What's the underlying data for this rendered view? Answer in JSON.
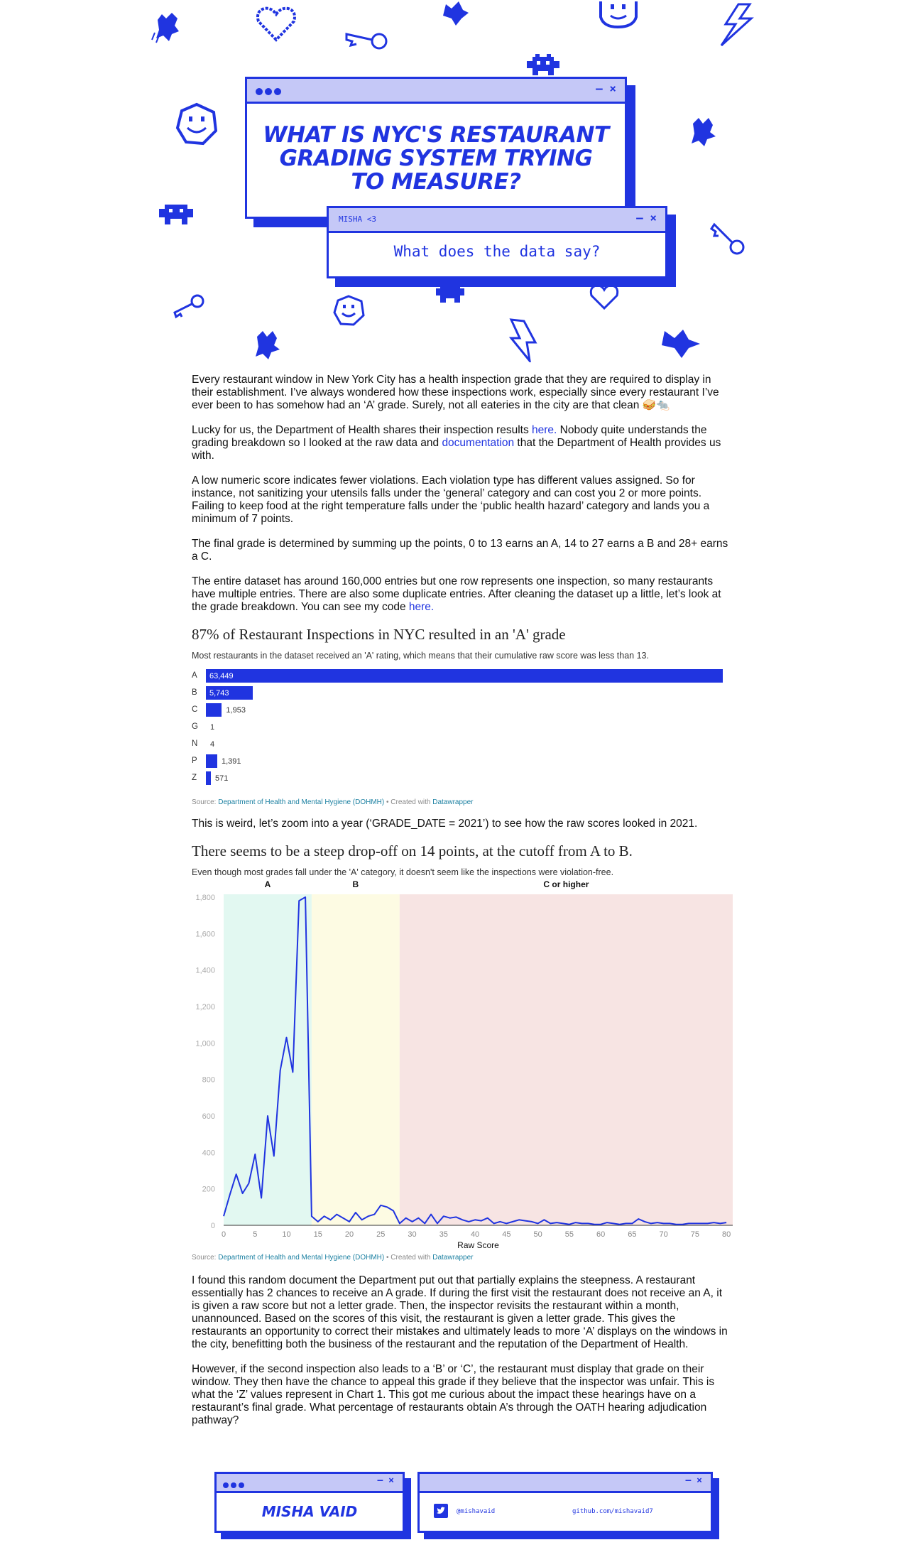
{
  "hero": {
    "title": "What is NYC's Restaurant Grading System Trying to Measure?",
    "sub_window_label": "MISHA <3",
    "subtitle": "What does the data say?",
    "window_controls": "– ×"
  },
  "colors": {
    "brand_blue": "#2034e0",
    "bar_bg": "#c5c8f7",
    "zone_a": "#e2f8f1",
    "zone_b": "#fdfbe3",
    "zone_c": "#f7e4e3"
  },
  "article": {
    "p1": "Every restaurant window in New York City has a health inspection grade that they are required to display in their establishment. I’ve always wondered how these inspections work, especially since every restaurant I’ve ever been to has somehow had an ‘A’ grade. Surely, not all eateries in the city are that clean 🥪🐀",
    "p2_a": "Lucky for us, the Department of Health shares their inspection results ",
    "p2_link1": "here.",
    "p2_b": " Nobody quite understands the grading breakdown so I looked at the raw data and ",
    "p2_link2": "documentation",
    "p2_c": " that the Department of Health provides us with.",
    "p3": "A low numeric score indicates fewer violations. Each violation type has different values assigned. So for instance, not sanitizing your utensils falls under the ‘general’ category and can cost you 2 or more points. Failing to keep food at the right temperature falls under the ‘public health hazard’ category and lands you a minimum of 7 points.",
    "p4": "The final grade is determined by summing up the points, 0 to 13 earns an A, 14 to 27 earns a B and 28+ earns a C.",
    "p5_a": "The entire dataset has around 160,000 entries but one row represents one inspection, so many restaurants have multiple entries. There are also some duplicate entries. After cleaning the dataset up a little, let’s look at the grade breakdown. You can see my code ",
    "p5_link": "here.",
    "p6": "This is weird, let’s zoom into a year (‘GRADE_DATE = 2021’) to see how the raw scores looked in 2021.",
    "p7": "I found this random document the Department put out that partially explains the steepness. A restaurant essentially has 2 chances to receive an A grade. If during the first visit the restaurant does not receive an A, it is given a raw score but not a letter grade. Then, the inspector revisits the restaurant within a month, unannounced. Based on the scores of this visit, the restaurant is given a letter grade. This gives the restaurants an opportunity to correct their mistakes and ultimately leads to more ‘A’ displays on the windows in the city, benefitting both the business of the restaurant and the reputation of the Department of Health.",
    "p8": "However, if the second inspection also leads to a ‘B’ or ‘C’, the restaurant must display that grade on their window. They then have the chance to appeal this grade if they believe that the inspector was unfair. This is what the ‘Z’ values represent in Chart 1. This got me curious about the impact these hearings have on a restaurant’s final grade. What percentage of restaurants obtain A’s through the OATH hearing adjudication pathway?"
  },
  "source": {
    "prefix": "Source: ",
    "link": "Department of Health and Mental Hygiene (DOHMH)",
    "middle": " • Created with ",
    "tool": "Datawrapper"
  },
  "chart_data": [
    {
      "type": "bar",
      "title": "87% of Restaurant Inspections in NYC resulted in an 'A' grade",
      "description": "Most restaurants in the dataset received an 'A' rating, which means that their cumulative raw score was less than 13.",
      "categories": [
        "A",
        "B",
        "C",
        "G",
        "N",
        "P",
        "Z"
      ],
      "values": [
        63449,
        5743,
        1953,
        1,
        4,
        1391,
        571
      ],
      "labels": [
        "63,449",
        "5,743",
        "1,953",
        "1",
        "4",
        "1,391",
        "571"
      ],
      "xlim": [
        0,
        63449
      ]
    },
    {
      "type": "line",
      "title": "There seems to be a steep drop-off on 14 points, at the cutoff from A to B.",
      "description": "Even though most grades fall under the 'A' category, it doesn't seem like the inspections were violation-free.",
      "xlabel": "Raw Score",
      "ylabel": "",
      "xlim": [
        0,
        81
      ],
      "ylim": [
        0,
        1800
      ],
      "x_ticks": [
        0,
        5,
        10,
        15,
        20,
        25,
        30,
        35,
        40,
        45,
        50,
        55,
        60,
        65,
        70,
        75,
        80
      ],
      "y_ticks": [
        0,
        200,
        400,
        600,
        800,
        1000,
        1200,
        1400,
        1600,
        1800
      ],
      "y_tick_labels": [
        "0",
        "200",
        "400",
        "600",
        "800",
        "1,000",
        "1,200",
        "1,400",
        "1,600",
        "1,800"
      ],
      "zones": [
        {
          "label": "A",
          "from": 0,
          "to": 14
        },
        {
          "label": "B",
          "from": 14,
          "to": 28
        },
        {
          "label": "C or higher",
          "from": 28,
          "to": 81
        }
      ],
      "x": [
        0,
        1,
        2,
        3,
        4,
        5,
        6,
        7,
        8,
        9,
        10,
        11,
        12,
        13,
        14,
        15,
        16,
        17,
        18,
        19,
        20,
        21,
        22,
        23,
        24,
        25,
        26,
        27,
        28,
        29,
        30,
        31,
        32,
        33,
        34,
        35,
        36,
        37,
        38,
        39,
        40,
        41,
        42,
        43,
        44,
        45,
        46,
        47,
        48,
        49,
        50,
        51,
        52,
        53,
        54,
        55,
        56,
        57,
        58,
        59,
        60,
        61,
        62,
        63,
        64,
        65,
        66,
        67,
        68,
        69,
        70,
        71,
        72,
        73,
        74,
        75,
        76,
        77,
        78,
        79,
        80
      ],
      "y": [
        50,
        170,
        280,
        175,
        230,
        390,
        150,
        600,
        380,
        850,
        1030,
        840,
        1780,
        1800,
        50,
        20,
        50,
        30,
        60,
        40,
        20,
        70,
        30,
        50,
        60,
        110,
        100,
        80,
        10,
        40,
        20,
        40,
        10,
        60,
        10,
        50,
        40,
        45,
        30,
        20,
        30,
        25,
        40,
        10,
        20,
        10,
        20,
        30,
        25,
        20,
        10,
        30,
        10,
        15,
        10,
        5,
        15,
        10,
        10,
        5,
        5,
        15,
        10,
        5,
        10,
        10,
        35,
        20,
        10,
        15,
        10,
        10,
        5,
        5,
        10,
        10,
        10,
        10,
        15,
        10,
        15
      ]
    }
  ],
  "footer": {
    "author": "Misha Vaid",
    "twitter": "@mishavaid",
    "github": "github.com/mishavaid7"
  }
}
